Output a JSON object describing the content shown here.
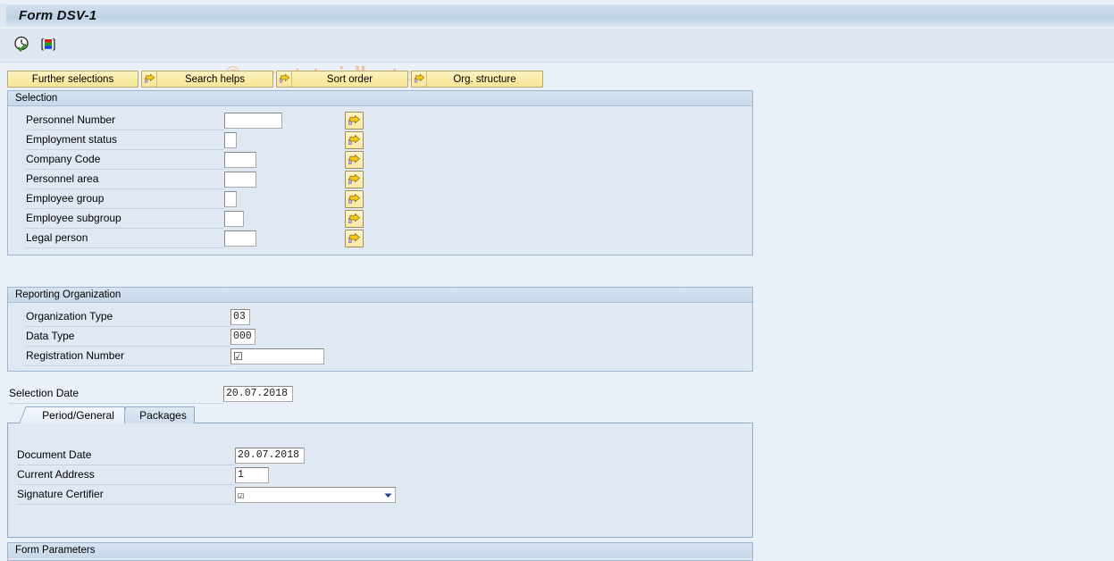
{
  "window": {
    "title": "Form DSV-1"
  },
  "watermark": {
    "text": "© www.tutorialkart.com"
  },
  "toolbar": {
    "icons": [
      {
        "name": "execute-clock-check-icon",
        "title": "Execute"
      },
      {
        "name": "multiple-selection-icon",
        "title": "Multiple selection"
      }
    ]
  },
  "button_row": [
    {
      "label": "Further selections",
      "has_arrow": false
    },
    {
      "label": "Search helps",
      "has_arrow": true
    },
    {
      "label": "Sort order",
      "has_arrow": true
    },
    {
      "label": "Org. structure",
      "has_arrow": true
    }
  ],
  "selection_panel": {
    "header": "Selection",
    "rows": [
      {
        "label": "Personnel Number",
        "value": "",
        "input_width": 65,
        "has_arrow": true
      },
      {
        "label": "Employment status",
        "value": "",
        "input_width": 14,
        "has_arrow": true
      },
      {
        "label": "Company Code",
        "value": "",
        "input_width": 36,
        "has_arrow": true
      },
      {
        "label": "Personnel area",
        "value": "",
        "input_width": 36,
        "has_arrow": true
      },
      {
        "label": "Employee group",
        "value": "",
        "input_width": 14,
        "has_arrow": true
      },
      {
        "label": "Employee subgroup",
        "value": "",
        "input_width": 22,
        "has_arrow": true
      },
      {
        "label": "Legal person",
        "value": "",
        "input_width": 36,
        "has_arrow": true
      }
    ]
  },
  "reporting_panel": {
    "header": "Reporting Organization",
    "rows": [
      {
        "label": "Organization Type",
        "value": "03",
        "input_width": 22
      },
      {
        "label": "Data Type",
        "value": "000",
        "input_width": 28
      },
      {
        "label": "Registration Number",
        "value": "☑",
        "input_width": 105
      }
    ]
  },
  "selection_date": {
    "label": "Selection Date",
    "value": "20.07.2018"
  },
  "tabs": [
    {
      "label": "Period/General",
      "active": true
    },
    {
      "label": "Packages",
      "active": false
    }
  ],
  "tab_content": {
    "rows": [
      {
        "label": "Document Date",
        "value": "20.07.2018",
        "type": "text",
        "input_width": 78
      },
      {
        "label": "Current Address",
        "value": "1",
        "type": "text",
        "input_width": 38
      },
      {
        "label": "Signature Certifier",
        "value": "☑",
        "type": "dropdown",
        "input_width": 180
      }
    ]
  },
  "form_parameters": {
    "header": "Form Parameters"
  },
  "colors": {
    "background": "#eaf0f7",
    "panel_bg": "#e0e9f3",
    "panel_border": "#9cb5d1",
    "button_yellow": "#f9e9a4",
    "watermark": "#f0c39a",
    "title_bar": "#c3d5e8"
  }
}
